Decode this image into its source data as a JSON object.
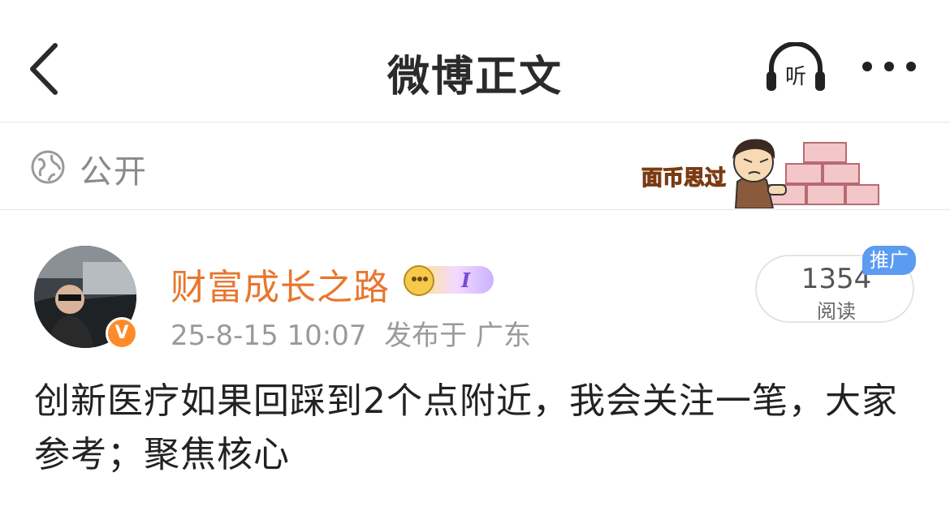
{
  "nav": {
    "title": "微博正文",
    "listen_label": "听"
  },
  "visibility": {
    "label": "公开",
    "sticker_text": "面币思过"
  },
  "post": {
    "username": "财富成长之路",
    "level_badge": "I",
    "timestamp": "25-8-15 10:07",
    "source": "发布于 广东",
    "read_count": "1354",
    "read_label": "阅读",
    "ad_tag": "推广",
    "verified_badge": "V",
    "content": "创新医疗如果回踩到2个点附近，我会关注一笔，大家参考；聚焦核心"
  },
  "colors": {
    "username": "#e8762d",
    "ad_tag": "#5b9bf0",
    "verified": "#ff8a2a"
  },
  "icons": [
    "back-arrow-icon",
    "headphones-icon",
    "more-dots-icon",
    "globe-icon"
  ]
}
